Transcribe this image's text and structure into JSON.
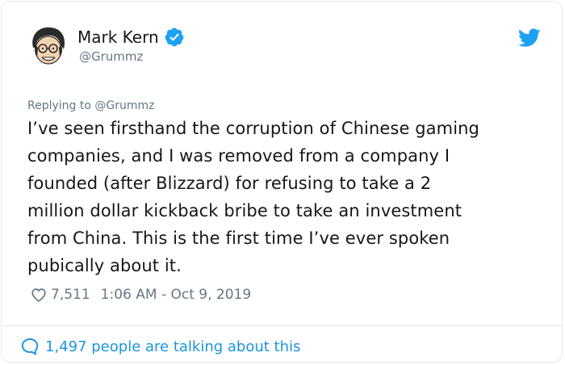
{
  "author": {
    "display_name": "Mark Kern",
    "handle": "@Grummz",
    "verified": true,
    "avatar_icon": "cartoon-avatar-icon"
  },
  "tweet": {
    "replying_to": "Replying to @Grummz",
    "lines": [
      "I’ve seen firsthand the corruption of Chinese gaming",
      "companies, and I was removed  from a company I",
      "founded (after Blizzard) for refusing to take a 2",
      "million dollar kickback bribe to take an investment",
      "from China. This is the first time I’ve ever spoken",
      "pubically about it."
    ],
    "likes": "7,511",
    "timestamp": "1:06 AM - Oct 9, 2019"
  },
  "footer": {
    "talking_label": "1,497 people are talking about this"
  },
  "colors": {
    "twitter_blue": "#1da1f2",
    "link_blue": "#1b95e0",
    "text": "#14171a",
    "muted": "#657786",
    "border": "#e1e8ed"
  }
}
